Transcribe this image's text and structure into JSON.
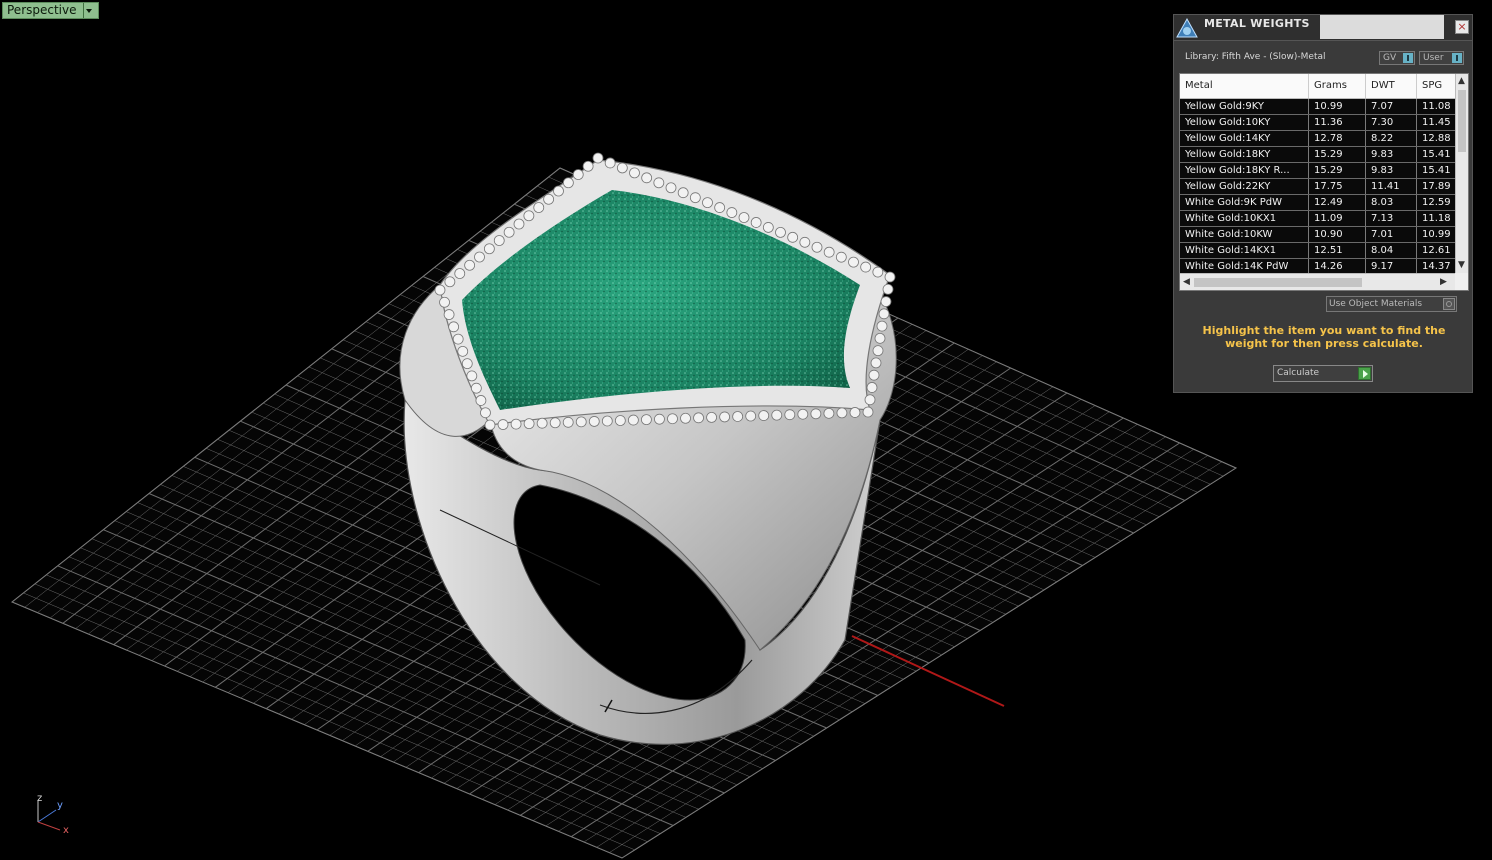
{
  "viewport": {
    "label": "Perspective",
    "axis_labels": {
      "x": "x",
      "y": "y",
      "z": "z"
    },
    "colors": {
      "background": "#000000",
      "grid": "#7a7a7a",
      "x_axis": "#b01818",
      "metal": "#c8c8c8",
      "gems": "#1f8f6a"
    }
  },
  "panel": {
    "title": "METAL WEIGHTS",
    "close_label": "×",
    "library": "Library: Fifth Ave - (Slow)-Metal",
    "toggle_gv": "GV",
    "toggle_user": "User",
    "columns": [
      "Metal",
      "Grams",
      "DWT",
      "SPG"
    ],
    "rows": [
      [
        "Yellow Gold:9KY",
        "10.99",
        "7.07",
        "11.08"
      ],
      [
        "Yellow Gold:10KY",
        "11.36",
        "7.30",
        "11.45"
      ],
      [
        "Yellow Gold:14KY",
        "12.78",
        "8.22",
        "12.88"
      ],
      [
        "Yellow Gold:18KY",
        "15.29",
        "9.83",
        "15.41"
      ],
      [
        "Yellow Gold:18KY R...",
        "15.29",
        "9.83",
        "15.41"
      ],
      [
        "Yellow Gold:22KY",
        "17.75",
        "11.41",
        "17.89"
      ],
      [
        "White Gold:9K PdW",
        "12.49",
        "8.03",
        "12.59"
      ],
      [
        "White Gold:10KX1",
        "11.09",
        "7.13",
        "11.18"
      ],
      [
        "White Gold:10KW",
        "10.90",
        "7.01",
        "10.99"
      ],
      [
        "White Gold:14KX1",
        "12.51",
        "8.04",
        "12.61"
      ],
      [
        "White Gold:14K PdW",
        "14.26",
        "9.17",
        "14.37"
      ]
    ],
    "use_object_materials": "Use Object Materials",
    "hint": "Highlight the item you want to find the weight for then press calculate.",
    "calculate_label": "Calculate",
    "colors": {
      "hint": "#f5c34a",
      "toggle_knob": "#67b2c6",
      "go": "#4aa24a"
    }
  }
}
